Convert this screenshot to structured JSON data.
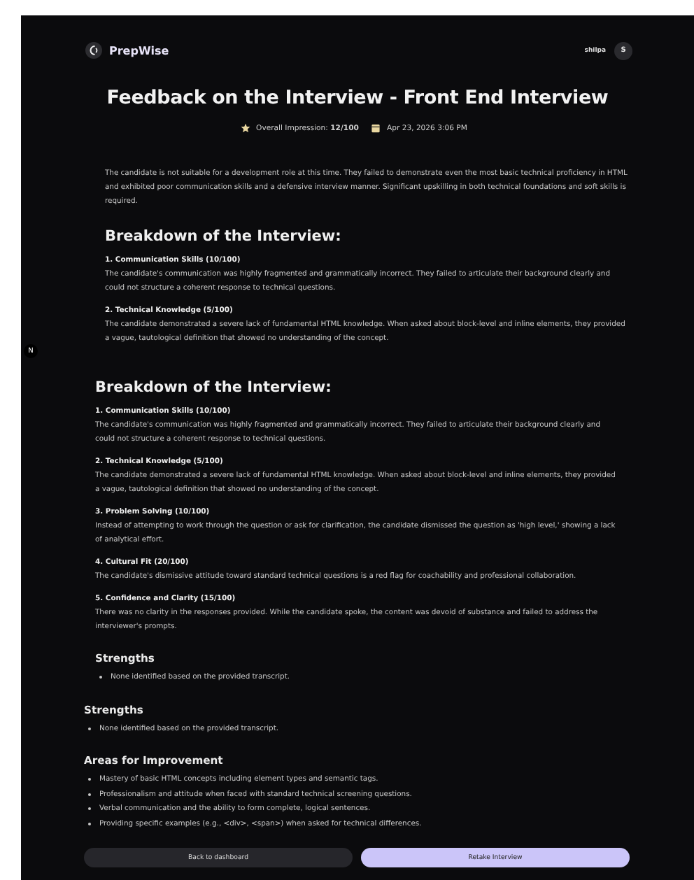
{
  "header": {
    "brand": "PrepWise",
    "user_name": "shilpa",
    "avatar_initial": "S"
  },
  "dev_badge": "N",
  "title": "Feedback on the Interview - Front End Interview",
  "meta": {
    "impression": "Overall Impression: **12/100**",
    "date": "Apr 23, 2026 3:06 PM"
  },
  "summary": "The candidate is not suitable for a development role at this time. They failed to demonstrate even the most basic technical proficiency in HTML and exhibited poor communication skills and a defensive interview manner. Significant upskilling in both technical foundations and soft skills is required.",
  "summary_breakdown": {
    "heading": "Breakdown of the Interview:",
    "items": [
      {
        "heading": "1. Communication Skills (10/100)",
        "text": "The candidate's communication was highly fragmented and grammatically incorrect. They failed to articulate their background clearly and could not structure a coherent response to technical questions."
      },
      {
        "heading": "2. Technical Knowledge (5/100)",
        "text": "The candidate demonstrated a severe lack of fundamental HTML knowledge. When asked about block-level and inline elements, they provided a vague, tautological definition that showed no understanding of the concept."
      }
    ]
  },
  "breakdown": {
    "heading": "Breakdown of the Interview:",
    "items": [
      {
        "heading": "1. Communication Skills (10/100)",
        "text": "The candidate's communication was highly fragmented and grammatically incorrect. They failed to articulate their background clearly and could not structure a coherent response to technical questions."
      },
      {
        "heading": "2. Technical Knowledge (5/100)",
        "text": "The candidate demonstrated a severe lack of fundamental HTML knowledge. When asked about block-level and inline elements, they provided a vague, tautological definition that showed no understanding of the concept."
      },
      {
        "heading": "3. Problem Solving (10/100)",
        "text": "Instead of attempting to work through the question or ask for clarification, the candidate dismissed the question as 'high level,' showing a lack of analytical effort."
      },
      {
        "heading": "4. Cultural Fit (20/100)",
        "text": "The candidate's dismissive attitude toward standard technical questions is a red flag for coachability and professional collaboration."
      },
      {
        "heading": "5. Confidence and Clarity (15/100)",
        "text": "There was no clarity in the responses provided. While the candidate spoke, the content was devoid of substance and failed to address the interviewer's prompts."
      }
    ],
    "strengths": {
      "heading": "Strengths",
      "bullets": [
        "None identified based on the provided transcript."
      ]
    }
  },
  "strengths": {
    "heading": "Strengths",
    "bullets": [
      "None identified based on the provided transcript."
    ]
  },
  "areas_for_improvement": {
    "heading": "Areas for Improvement",
    "bullets": [
      "Mastery of basic HTML concepts including element types and semantic tags.",
      "Professionalism and attitude when faced with standard technical screening questions.",
      "Verbal communication and the ability to form complete, logical sentences.",
      "Providing specific examples (e.g., <div>, <span>) when asked for technical differences."
    ]
  },
  "buttons": [
    {
      "label": "Back to dashboard",
      "kind": "secondary"
    },
    {
      "label": "Retake Interview",
      "kind": "primary"
    }
  ]
}
